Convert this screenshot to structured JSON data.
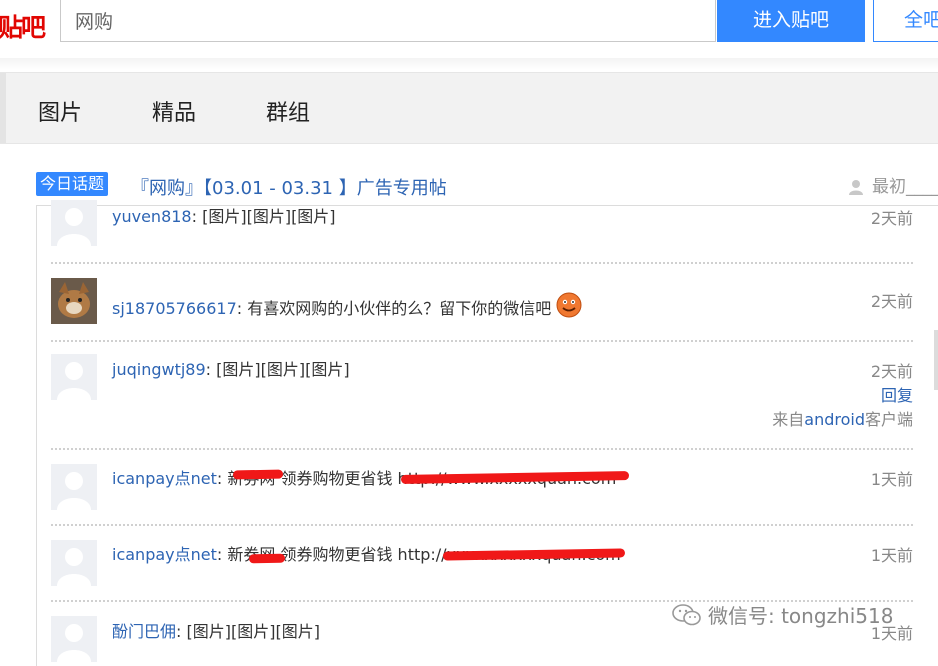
{
  "header": {
    "logo_text": "贴吧",
    "search_value": "网购",
    "enter_button": "进入贴吧",
    "all_button": "全吧"
  },
  "nav": {
    "items": [
      "图片",
      "精品",
      "群组"
    ]
  },
  "topic": {
    "badge": "今日话题",
    "title": "『网购』【03.01 - 03.31 】广告专用帖",
    "right_label": "最初____"
  },
  "posts": [
    {
      "user": "yuven818",
      "sep": ": ",
      "content": "[图片][图片][图片]",
      "time": "2天前"
    },
    {
      "user": "sj18705766617",
      "sep": ": ",
      "content": "有喜欢网购的小伙伴的么？留下你的微信吧",
      "time": "2天前",
      "emoji": "smiley-face-icon"
    },
    {
      "user": "juqingwtj89",
      "sep": ": ",
      "content": "[图片][图片][图片]",
      "time": "2天前",
      "reply": "回复",
      "from_prefix": "来自",
      "from_link": "android",
      "from_suffix": "客户端"
    },
    {
      "user": "icanpay点net",
      "sep": ": ",
      "content": "新券网 领券购物更省钱 http://www.xxxxxquan.com",
      "time": "1天前"
    },
    {
      "user": "icanpay点net",
      "sep": ": ",
      "content": "新券网 领券购物更省钱 http://xxxxxxxxxxquan.com",
      "time": "1天前"
    },
    {
      "user": "酚门巴佣",
      "sep": ": ",
      "content": "[图片][图片][图片]",
      "time": "1天前"
    }
  ],
  "watermark": {
    "text": "微信号: tongzhi518"
  },
  "colors": {
    "brand_blue": "#3388ff",
    "link_blue": "#2d64b3",
    "logo_red": "#e10602",
    "redaction_red": "#f01818"
  }
}
